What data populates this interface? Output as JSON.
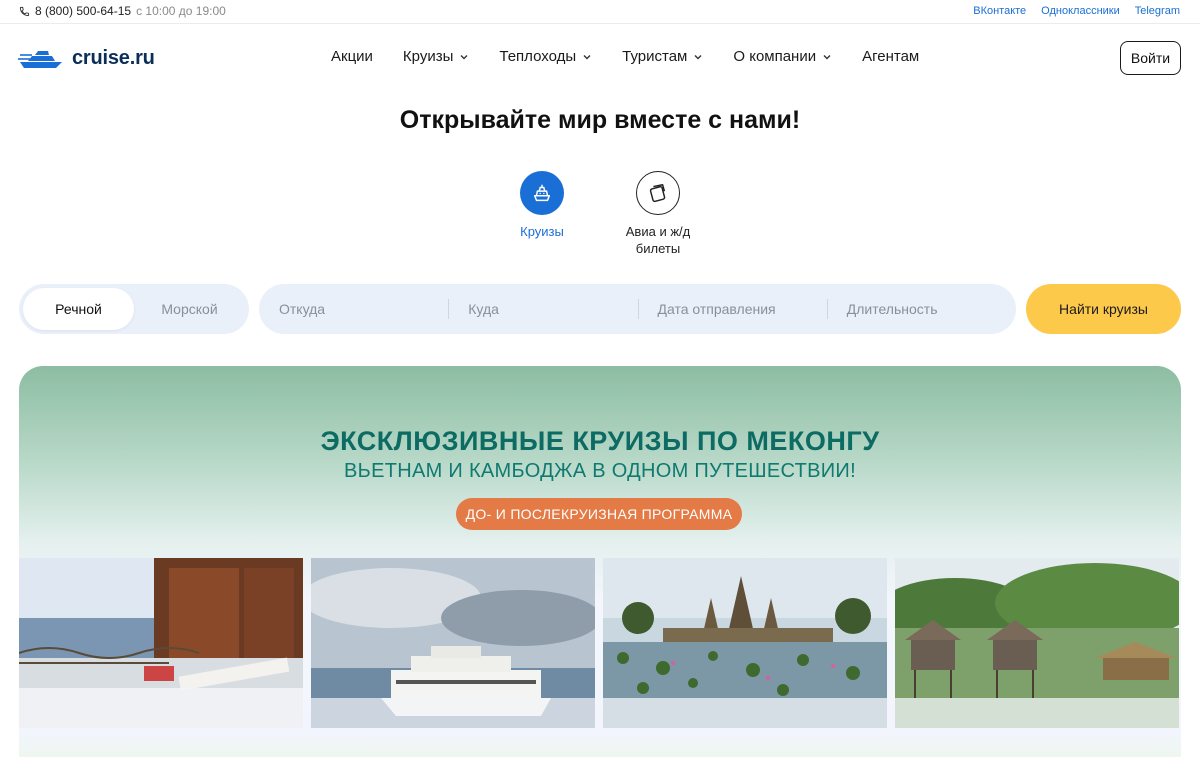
{
  "topbar": {
    "phone": "8 (800) 500-64-15",
    "hours": "с 10:00 до 19:00",
    "socials": [
      "ВКонтакте",
      "Одноклассники",
      "Telegram"
    ]
  },
  "header": {
    "logo_text": "cruise.ru",
    "nav": [
      {
        "label": "Акции",
        "has_dropdown": false
      },
      {
        "label": "Круизы",
        "has_dropdown": true
      },
      {
        "label": "Теплоходы",
        "has_dropdown": true
      },
      {
        "label": "Туристам",
        "has_dropdown": true
      },
      {
        "label": "О компании",
        "has_dropdown": true
      },
      {
        "label": "Агентам",
        "has_dropdown": false
      }
    ],
    "login_label": "Войти"
  },
  "hero": {
    "title": "Открывайте мир вместе с нами!",
    "modes": [
      {
        "label": "Круизы",
        "icon": "ship-icon",
        "active": true
      },
      {
        "label": "Авиа и ж/д\nбилеты",
        "icon": "ticket-icon",
        "active": false
      }
    ]
  },
  "search": {
    "types": [
      {
        "label": "Речной",
        "active": true
      },
      {
        "label": "Морской",
        "active": false
      }
    ],
    "fields": {
      "from": "Откуда",
      "to": "Куда",
      "date": "Дата отправления",
      "duration": "Длительность"
    },
    "submit_label": "Найти круизы"
  },
  "banner": {
    "title": "ЭКСКЛЮЗИВНЫЕ КРУИЗЫ ПО МЕКОНГУ",
    "subtitle": "ВЬЕТНАМ И КАМБОДЖА В ОДНОМ ПУТЕШЕСТВИИ!",
    "pill": "ДО- И ПОСЛЕКРУИЗНАЯ ПРОГРАММА",
    "photos": [
      "balcony-photo",
      "river-ship-photo",
      "angkor-wat-photo",
      "stilt-houses-photo"
    ]
  },
  "colors": {
    "accent_blue": "#1a6fd6",
    "cta_yellow": "#fdc94a",
    "banner_green": "#0c6b63",
    "pill_orange": "#e47a45",
    "search_bg": "#eaf0fa"
  }
}
